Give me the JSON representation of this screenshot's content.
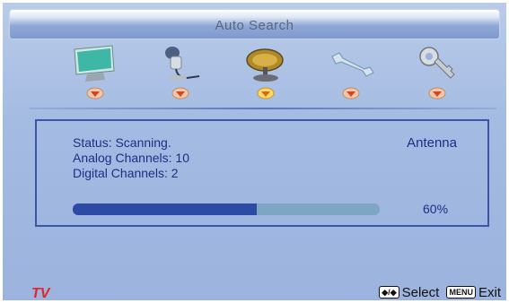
{
  "header": {
    "title": "Auto Search"
  },
  "menu": {
    "items": [
      {
        "icon": "monitor-icon"
      },
      {
        "icon": "microphone-icon"
      },
      {
        "icon": "satellite-dish-icon"
      },
      {
        "icon": "wrench-icon"
      },
      {
        "icon": "key-icon"
      }
    ],
    "selected_index": 2
  },
  "status": {
    "status_line": "Status:  Scanning.",
    "analog_line": "Analog  Channels:  10",
    "digital_line": "Digital  Channels:  2",
    "source": "Antenna",
    "progress_percent": 60,
    "progress_label": "60%"
  },
  "footer": {
    "mode": "TV",
    "nav_key_label": "◆/◆",
    "select_label": "Select",
    "menu_key_label": "MENU",
    "exit_label": "Exit"
  },
  "colors": {
    "accent_text": "#1f2d86",
    "progress_fill": "#2d4aa5",
    "progress_track": "#7ea6c3",
    "tv_red": "#e0262b"
  }
}
